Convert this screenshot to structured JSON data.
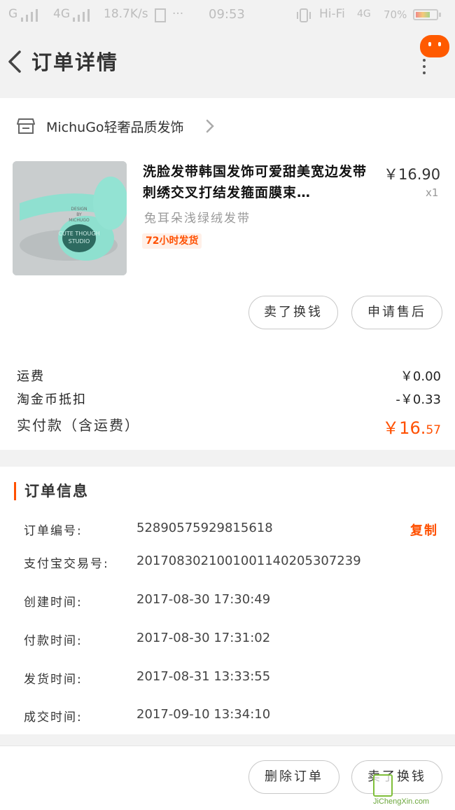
{
  "status_bar": {
    "signal_left": "G",
    "network": "4G",
    "speed": "18.7K/s",
    "time": "09:53",
    "wifi": "Hi-Fi",
    "network_right": "4G",
    "battery": "70%"
  },
  "nav": {
    "title": "订单详情"
  },
  "shop": {
    "name": "MichuGo轻奢品质发饰"
  },
  "product": {
    "title": "洗脸发带韩国发饰可爱甜美宽边发带刺绣交叉打结发箍面膜束…",
    "price": "￥16.90",
    "quantity": "x1",
    "sku": "兔耳朵浅绿绒发带",
    "tag": "72小时发货",
    "thumb_text_1": "DESIGN",
    "thumb_text_2": "BY",
    "thumb_text_3": "MICHUGO",
    "thumb_text_4": "CUTE THOUGH",
    "thumb_text_5": "STUDIO"
  },
  "actions": {
    "sell_label": "卖了换钱",
    "aftersale_label": "申请售后",
    "delete_label": "删除订单"
  },
  "fees": {
    "shipping_label": "运费",
    "shipping_value": "￥0.00",
    "coin_label": "淘金币抵扣",
    "coin_value": "-￥0.33",
    "total_label": "实付款（含运费）",
    "total_main": "￥16.",
    "total_cents": "57"
  },
  "order_info": {
    "title": "订单信息",
    "copy_label": "复制",
    "rows": [
      {
        "key": "订单编号:",
        "value": "52890575929815618"
      },
      {
        "key": "支付宝交易号:",
        "value": "2017083021001001140205307239"
      },
      {
        "key": "创建时间:",
        "value": "2017-08-30 17:30:49"
      },
      {
        "key": "付款时间:",
        "value": "2017-08-30 17:31:02"
      },
      {
        "key": "发货时间:",
        "value": "2017-08-31 13:33:55"
      },
      {
        "key": "成交时间:",
        "value": "2017-09-10 13:34:10"
      }
    ]
  },
  "watermark": {
    "text": "JiChengXin.com"
  },
  "colors": {
    "accent": "#ff5000",
    "background": "#f2f2f2",
    "product_mint": "#8fe0d0"
  }
}
